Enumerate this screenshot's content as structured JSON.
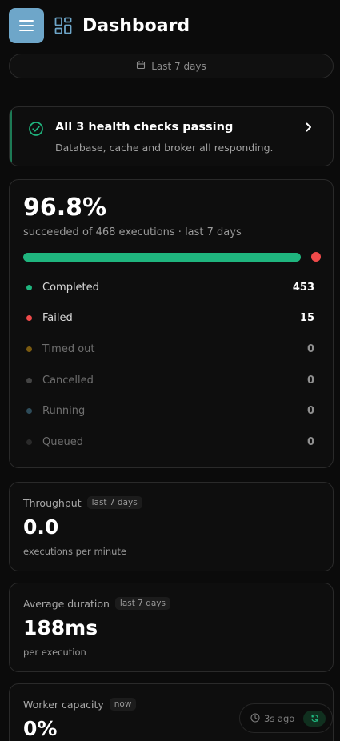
{
  "header": {
    "title": "Dashboard"
  },
  "date_range": {
    "label": "Last 7 days"
  },
  "health": {
    "title": "All 3 health checks passing",
    "subtitle": "Database, cache and broker all responding."
  },
  "executions": {
    "success_rate": "96.8%",
    "subtitle": "succeeded of 468 executions · last 7 days",
    "success_fraction": 0.968,
    "statuses": [
      {
        "label": "Completed",
        "count": "453",
        "color": "#1fb57e",
        "label_color": "#d8d8d8",
        "value_color": "#ffffff"
      },
      {
        "label": "Failed",
        "count": "15",
        "color": "#ef4a4a",
        "label_color": "#d8d8d8",
        "value_color": "#ffffff"
      },
      {
        "label": "Timed out",
        "count": "0",
        "color": "#7a5a10",
        "label_color": "#6e6e6e",
        "value_color": "#8f8f8f"
      },
      {
        "label": "Cancelled",
        "count": "0",
        "color": "#444444",
        "label_color": "#6e6e6e",
        "value_color": "#8f8f8f"
      },
      {
        "label": "Running",
        "count": "0",
        "color": "#2e4c5a",
        "label_color": "#6e6e6e",
        "value_color": "#8f8f8f"
      },
      {
        "label": "Queued",
        "count": "0",
        "color": "#2a2a2a",
        "label_color": "#6e6e6e",
        "value_color": "#8f8f8f"
      }
    ]
  },
  "metrics": {
    "throughput": {
      "title": "Throughput",
      "chip": "last 7 days",
      "value": "0.0",
      "sub": "executions per minute"
    },
    "duration": {
      "title": "Average duration",
      "chip": "last 7 days",
      "value": "188ms",
      "sub": "per execution"
    },
    "capacity": {
      "title": "Worker capacity",
      "chip": "now",
      "value": "0%"
    }
  },
  "refresh": {
    "ago": "3s ago"
  },
  "colors": {
    "accent_success": "#1fb57e",
    "accent_error": "#ef4a4a",
    "menu_button": "#6ea6c9"
  }
}
